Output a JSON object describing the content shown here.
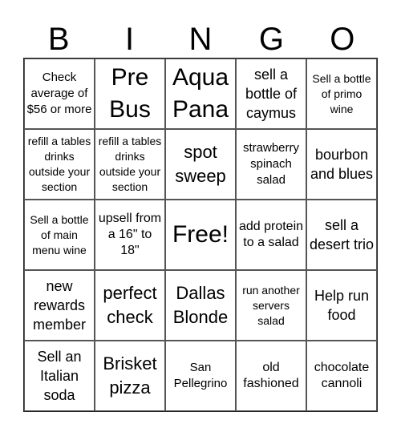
{
  "header": {
    "letters": [
      "B",
      "I",
      "N",
      "G",
      "O"
    ]
  },
  "card": {
    "rows": [
      [
        "Check average of $56 or more",
        "Pre Bus",
        "Aqua Pana",
        "sell a bottle of caymus",
        "Sell a bottle of primo wine"
      ],
      [
        "refill a tables drinks outside your section",
        "refill a tables drinks outside your section",
        "spot sweep",
        "strawberry spinach salad",
        "bourbon and blues"
      ],
      [
        "Sell a bottle of main menu wine",
        "upsell from a 16\" to 18\"",
        "Free!",
        "add protein to a salad",
        "sell a desert trio"
      ],
      [
        "new rewards member",
        "perfect check",
        "Dallas Blonde",
        "run another servers salad",
        "Help run food"
      ],
      [
        "Sell an Italian soda",
        "Brisket pizza",
        "San Pellegrino",
        "old fashioned",
        "chocolate cannoli"
      ]
    ]
  }
}
